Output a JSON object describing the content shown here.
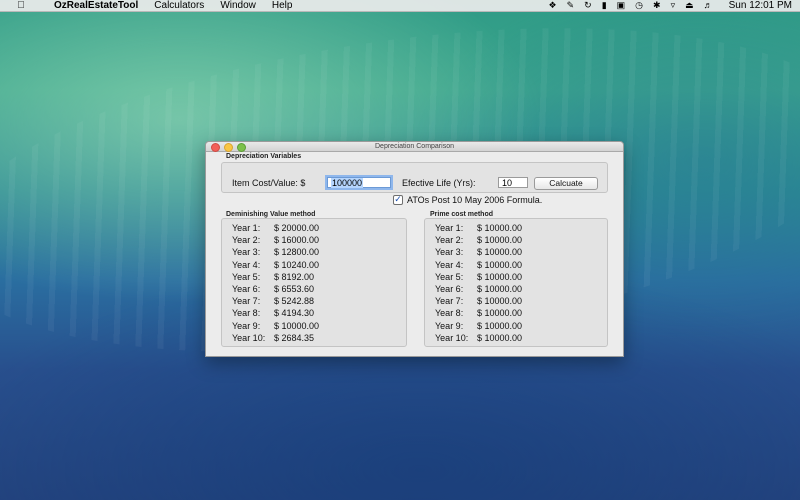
{
  "menubar": {
    "apple_icon": "apple-icon",
    "app_name": "OzRealEstateTool",
    "menus": [
      "Calculators",
      "Window",
      "Help"
    ],
    "status_icons": [
      "dropbox-icon",
      "evernote-icon",
      "sync-icon",
      "battery-icon",
      "airplay-icon",
      "time-machine-icon",
      "bluetooth-icon",
      "wifi-icon",
      "eject-icon",
      "volume-icon"
    ],
    "clock": "Sun 12:01 PM"
  },
  "window": {
    "title": "Depreciation Comparison",
    "variables_section_label": "Depreciation Variables",
    "item_cost_label": "Item Cost/Value:  $",
    "item_cost_value": "100000",
    "effective_life_label": "Efective Life (Yrs):",
    "effective_life_value": "10",
    "calculate_button": "Calcuate",
    "formula_checkbox_label": "ATOs Post 10 May 2006 Formula.",
    "formula_checked": true,
    "dv_section_label": "Deminishing Value method",
    "pc_section_label": "Prime cost method",
    "dv_rows": [
      {
        "year": "Year 1:",
        "value": "$ 20000.00"
      },
      {
        "year": "Year 2:",
        "value": "$ 16000.00"
      },
      {
        "year": "Year 3:",
        "value": "$ 12800.00"
      },
      {
        "year": "Year 4:",
        "value": "$ 10240.00"
      },
      {
        "year": "Year 5:",
        "value": "$ 8192.00"
      },
      {
        "year": "Year 6:",
        "value": "$ 6553.60"
      },
      {
        "year": "Year 7:",
        "value": "$ 5242.88"
      },
      {
        "year": "Year 8:",
        "value": "$ 4194.30"
      },
      {
        "year": "Year 9:",
        "value": "$ 10000.00"
      },
      {
        "year": "Year 10:",
        "value": "$ 2684.35"
      }
    ],
    "pc_rows": [
      {
        "year": "Year 1:",
        "value": "$ 10000.00"
      },
      {
        "year": "Year 2:",
        "value": "$ 10000.00"
      },
      {
        "year": "Year 3:",
        "value": "$ 10000.00"
      },
      {
        "year": "Year 4:",
        "value": "$ 10000.00"
      },
      {
        "year": "Year 5:",
        "value": "$ 10000.00"
      },
      {
        "year": "Year 6:",
        "value": "$ 10000.00"
      },
      {
        "year": "Year 7:",
        "value": "$ 10000.00"
      },
      {
        "year": "Year 8:",
        "value": "$ 10000.00"
      },
      {
        "year": "Year 9:",
        "value": "$ 10000.00"
      },
      {
        "year": "Year 10:",
        "value": "$ 10000.00"
      }
    ]
  }
}
